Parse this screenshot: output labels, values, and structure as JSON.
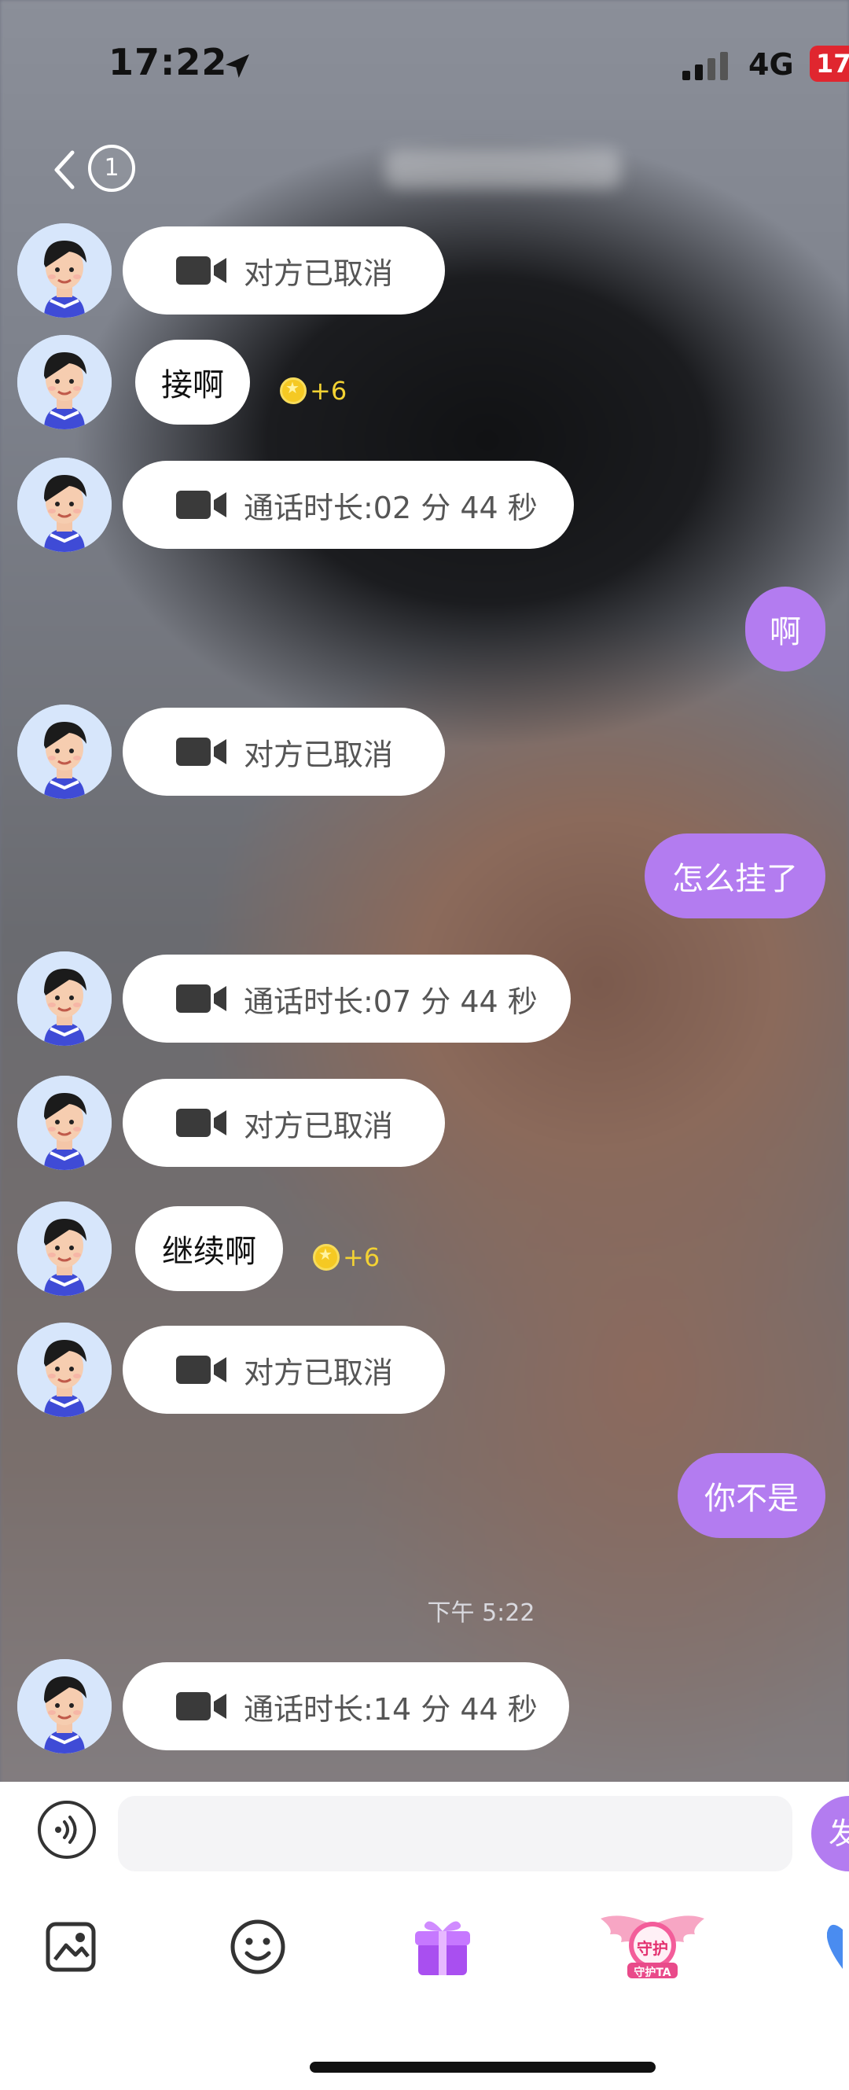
{
  "status_bar": {
    "time": "17:22",
    "network": "4G",
    "battery": "17"
  },
  "nav": {
    "unread_count": "1"
  },
  "messages": [
    {
      "type": "call",
      "text": "对方已取消"
    },
    {
      "type": "text",
      "text": "接啊",
      "reward": "+6"
    },
    {
      "type": "call",
      "text": "通话时长:02 分 44 秒"
    },
    {
      "type": "mine",
      "text": "啊"
    },
    {
      "type": "call",
      "text": "对方已取消"
    },
    {
      "type": "mine",
      "text": "怎么挂了"
    },
    {
      "type": "call",
      "text": "通话时长:07 分 44 秒"
    },
    {
      "type": "call",
      "text": "对方已取消"
    },
    {
      "type": "text",
      "text": "继续啊",
      "reward": "+6"
    },
    {
      "type": "call",
      "text": "对方已取消"
    },
    {
      "type": "mine",
      "text": "你不是"
    },
    {
      "type": "call",
      "text": "通话时长:14 分 44 秒"
    }
  ],
  "timestamp": "下午 5:22",
  "composer": {
    "input_placeholder": "",
    "send_label": "发"
  },
  "toolbar": {
    "items": [
      "image-icon",
      "emoji-icon",
      "gift-icon",
      "guard-icon",
      "heart-icon"
    ],
    "guard_label": "守护",
    "guard_sub_label": "守护TA"
  },
  "colors": {
    "accent": "#b37cf0",
    "coin": "#f5c923",
    "avatar_bg": "#d7e6fb"
  }
}
